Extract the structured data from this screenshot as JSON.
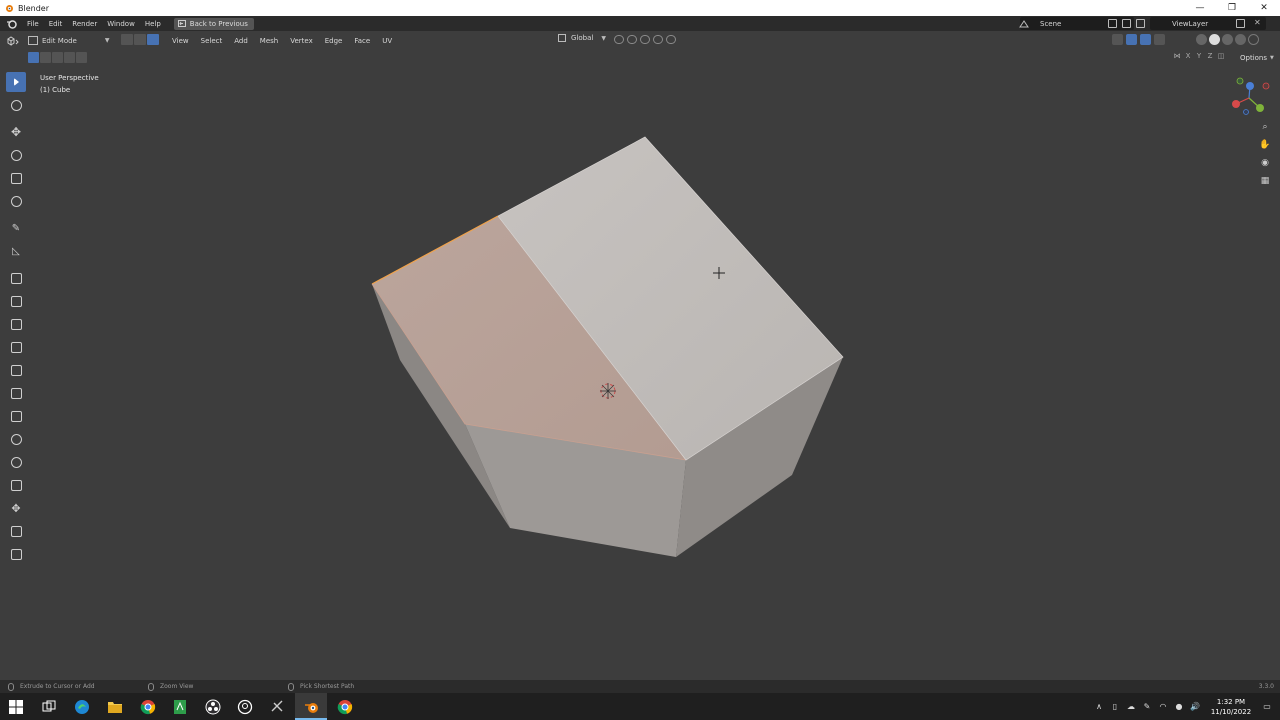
{
  "window": {
    "title": "Blender",
    "controls": [
      "—",
      "❐",
      "✕"
    ]
  },
  "topbar": {
    "menus": [
      "File",
      "Edit",
      "Render",
      "Window",
      "Help"
    ],
    "back_button": "Back to Previous",
    "scene": "Scene",
    "view_layer": "ViewLayer"
  },
  "viewport_header": {
    "mode": "Edit Mode",
    "menus": [
      "View",
      "Select",
      "Add",
      "Mesh",
      "Vertex",
      "Edge",
      "Face",
      "UV"
    ],
    "transform_orientation": "Global",
    "axes": [
      "X",
      "Y",
      "Z"
    ],
    "options_label": "Options"
  },
  "viewport": {
    "view_name": "User Perspective",
    "object_name": "(1) Cube"
  },
  "colors": {
    "accent": "#4772b3",
    "selected_face": "#b8a097",
    "selected_edge": "#f0a24a",
    "face_light": "#bcb8b5"
  },
  "statusbar": {
    "left_action": "Extrude to Cursor or Add",
    "middle_action": "Zoom View",
    "right_action": "Pick Shortest Path",
    "version": "3.3.0"
  },
  "taskbar": {
    "time": "1:32 PM",
    "date": "11/10/2022"
  }
}
